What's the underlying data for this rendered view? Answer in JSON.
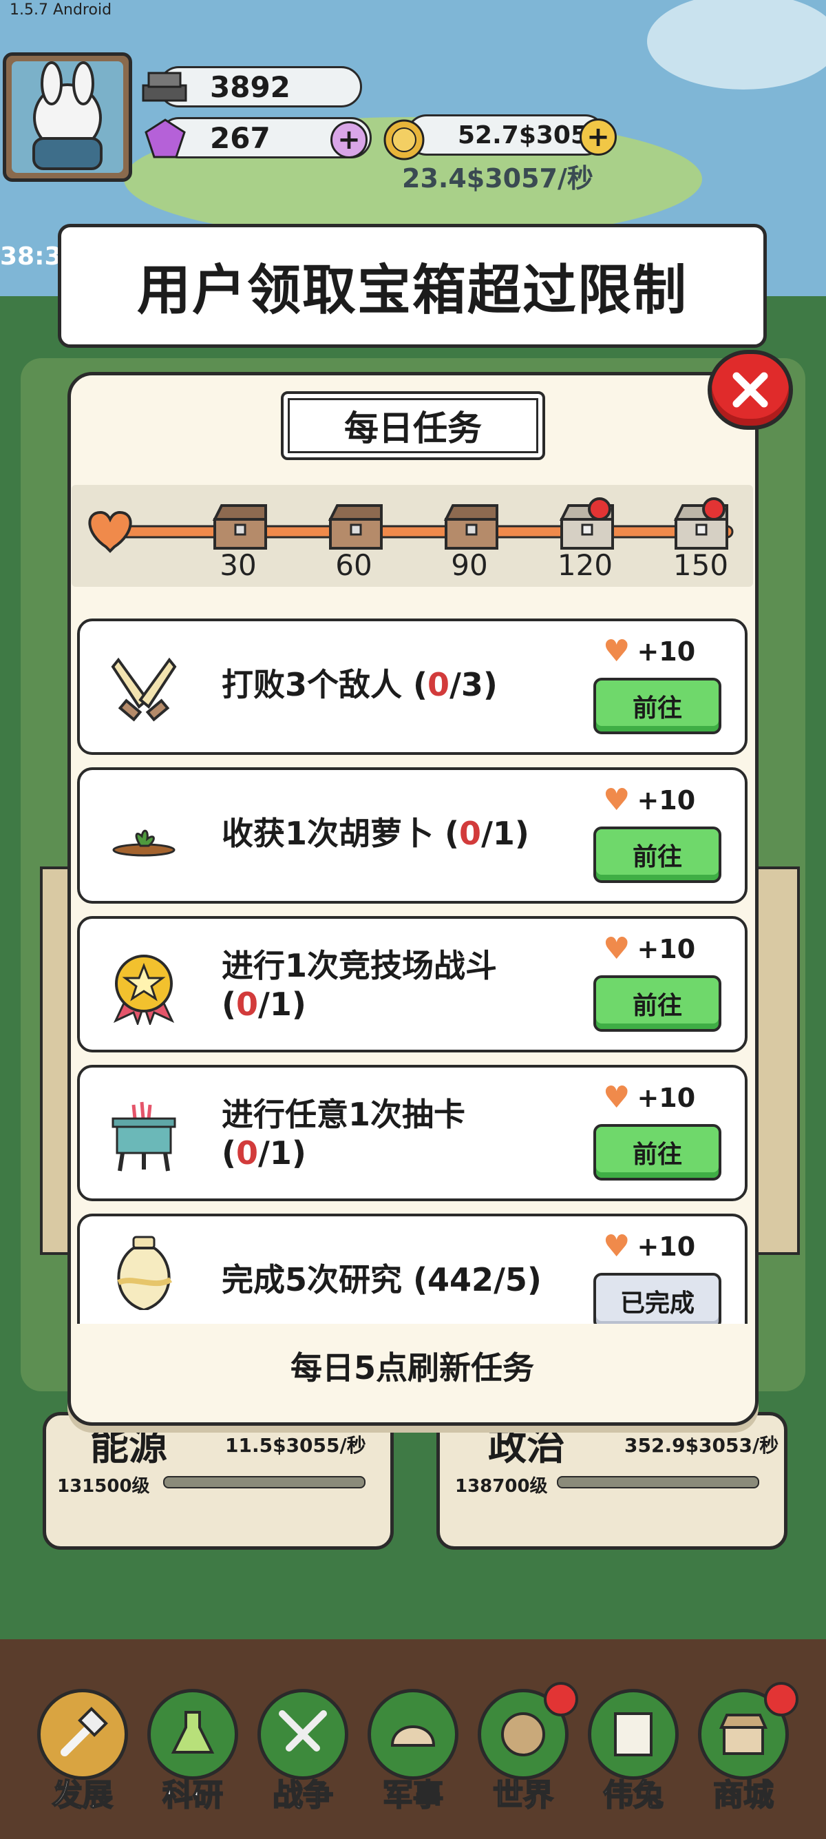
{
  "version": "1.5.7 Android",
  "hud": {
    "iron": "3892",
    "gems": "267",
    "coins": "52.7$3058",
    "coin_rate": "23.4$3057/秒",
    "timer": "38:3"
  },
  "toast": {
    "message": "用户领取宝箱超过限制"
  },
  "modal": {
    "title": "每日任务",
    "milestones": [
      "30",
      "60",
      "90",
      "120",
      "150"
    ],
    "footer": "每日5点刷新任务"
  },
  "tasks": [
    {
      "name": "打败3个敌人 (",
      "current": "0",
      "total": "/3)",
      "reward": "+10",
      "button": "前往",
      "icon": "crossed-swords-icon",
      "completed": false
    },
    {
      "name": "收获1次胡萝卜 (",
      "current": "0",
      "total": "/1)",
      "reward": "+10",
      "button": "前往",
      "icon": "carrot-sprout-icon",
      "completed": false
    },
    {
      "name": "进行1次竞技场战斗",
      "name2": "(",
      "current": "0",
      "total": "/1)",
      "reward": "+10",
      "button": "前往",
      "icon": "star-medal-icon",
      "completed": false
    },
    {
      "name": "进行任意1次抽卡",
      "name2": "(",
      "current": "0",
      "total": "/1)",
      "reward": "+10",
      "button": "前往",
      "icon": "bronze-cauldron-icon",
      "completed": false
    },
    {
      "name": "完成5次研究 (442/5)",
      "reward": "+10",
      "button": "已完成",
      "icon": "vase-icon",
      "completed": true
    }
  ],
  "lower_cards": [
    {
      "title": "能源",
      "rate": "11.5$3055/秒",
      "level": "131500级"
    },
    {
      "title": "政治",
      "rate": "352.9$3053/秒",
      "level": "138700级"
    }
  ],
  "nav": [
    {
      "label": "发展",
      "icon": "hammer-icon"
    },
    {
      "label": "科研",
      "icon": "flask-icon"
    },
    {
      "label": "战争",
      "icon": "swords-icon"
    },
    {
      "label": "军事",
      "icon": "helmet-icon"
    },
    {
      "label": "世界",
      "icon": "globe-icon"
    },
    {
      "label": "伟兔",
      "icon": "rabbit-portrait-icon"
    },
    {
      "label": "商城",
      "icon": "shop-icon"
    }
  ],
  "colors": {
    "accent_green": "#6fd86b",
    "close_red": "#e02b2b",
    "progress_orange": "#f08a4b",
    "highlight_red": "#d23b3b"
  }
}
